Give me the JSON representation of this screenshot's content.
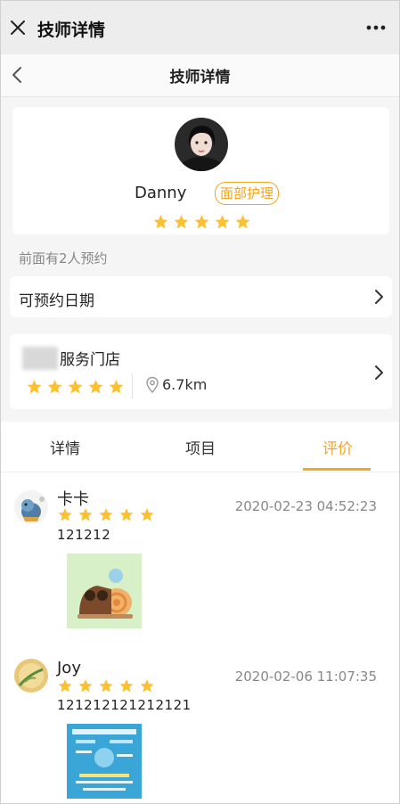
{
  "window": {
    "title": "技师详情",
    "close_icon": "close-icon",
    "more_icon": "more-icon"
  },
  "nav": {
    "title": "技师详情",
    "back_icon": "back-chevron-icon"
  },
  "profile": {
    "name": "Danny",
    "tag": "面部护理",
    "rating": 5,
    "max_rating": 5
  },
  "queue_text": "前面有2人预约",
  "booking": {
    "label": "可预约日期"
  },
  "store": {
    "name": "服务门店",
    "rating": 5,
    "distance": "6.7km"
  },
  "tabs": [
    {
      "label": "详情",
      "active": false
    },
    {
      "label": "项目",
      "active": false
    },
    {
      "label": "评价",
      "active": true
    }
  ],
  "reviews": [
    {
      "name": "卡卡",
      "time": "2020-02-23 04:52:23",
      "rating": 5,
      "text": "121212",
      "has_image": true
    },
    {
      "name": "Joy",
      "time": "2020-02-06 11:07:35",
      "rating": 5,
      "text": "121212121212121",
      "has_image": true
    }
  ],
  "colors": {
    "accent": "#f5a623",
    "star": "#fdc02f",
    "muted_text": "#888888",
    "background": "#f5f5f5"
  }
}
